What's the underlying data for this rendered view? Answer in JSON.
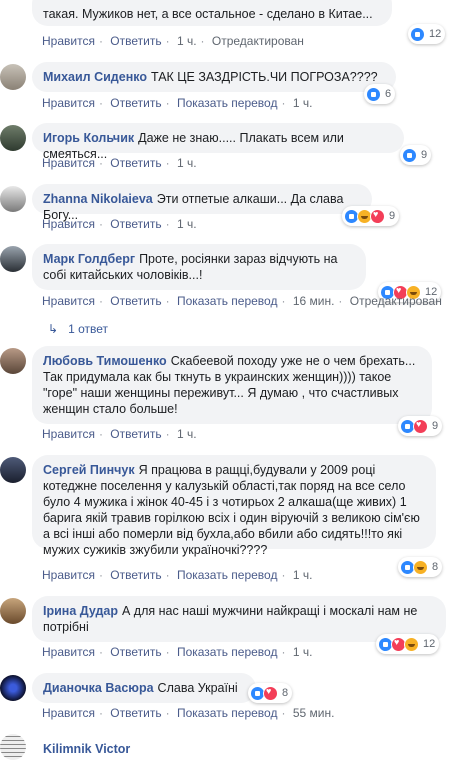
{
  "comments": [
    {
      "author": "",
      "text": "такая. Мужиков нет, а все остальное - сделано в Китае...",
      "actions": [
        "Нравится",
        "Ответить"
      ],
      "time": "1 ч.",
      "edited": "Отредактирован",
      "reactions": [
        "like"
      ],
      "reaction_count": "12"
    },
    {
      "author": "Михаил Сиденко",
      "text": "ТАК ЦЕ ЗАЗДРІСТЬ.ЧИ ПОГРОЗА????",
      "actions": [
        "Нравится",
        "Ответить",
        "Показать перевод"
      ],
      "time": "1 ч.",
      "reactions": [
        "like"
      ],
      "reaction_count": "6"
    },
    {
      "author": "Игорь Кольчик",
      "text": "Даже не знаю..... Плакать всем или смеяться...",
      "actions": [
        "Нравится",
        "Ответить"
      ],
      "time": "1 ч.",
      "reactions": [
        "like"
      ],
      "reaction_count": "9"
    },
    {
      "author": "Zhanna Nikolaieva",
      "text": "Эти отпетые алкаши... Да слава Богу...",
      "actions": [
        "Нравится",
        "Ответить"
      ],
      "time": "1 ч.",
      "reactions": [
        "like",
        "haha",
        "love"
      ],
      "reaction_count": "9"
    },
    {
      "author": "Марк Голдберг",
      "text": "Проте, росіянки зараз відчують на собі китайських чоловіків...!",
      "actions": [
        "Нравится",
        "Ответить",
        "Показать перевод"
      ],
      "time": "16 мин.",
      "edited": "Отредактирован",
      "reactions": [
        "like",
        "love",
        "haha"
      ],
      "reaction_count": "12"
    },
    {
      "author": "Любовь Тимошенко",
      "text": "Скабеевой походу уже не о чем брехать... Так придумала как бы ткнуть в украинских женщин)))) такое \"горе\" наши женщины переживут... Я думаю , что счастливых женщин стало больше!",
      "actions": [
        "Нравится",
        "Ответить"
      ],
      "time": "1 ч.",
      "reactions": [
        "like",
        "love"
      ],
      "reaction_count": "9"
    },
    {
      "author": "Сергей Пинчук",
      "text": "Я працюва в ращці,будували у 2009 році котеджне поселення у калузькій області,так поряд на все село було 4 мужика і жінок 40-45 і з чотирьох 2 алкаша(ще живих) 1 барига якій травив горілкою всіх і один віруючій з великою сім'єю а всі інші або померли від бухла,або вбили або сидять!!!то які мужих сужиків зжубили україночкі????",
      "actions": [
        "Нравится",
        "Ответить",
        "Показать перевод"
      ],
      "time": "1 ч.",
      "reactions": [
        "like",
        "haha"
      ],
      "reaction_count": "8"
    },
    {
      "author": "Iрина Дудар",
      "text": "А для нас наші мужчини найкращі і москалі нам не потрібні",
      "actions": [
        "Нравится",
        "Ответить",
        "Показать перевод"
      ],
      "time": "1 ч.",
      "reactions": [
        "like",
        "love",
        "haha"
      ],
      "reaction_count": "12"
    },
    {
      "author": "Дианочка Васюра",
      "text": "Слава Україні",
      "actions": [
        "Нравится",
        "Ответить",
        "Показать перевод"
      ],
      "time": "55 мин.",
      "reactions": [
        "like",
        "love"
      ],
      "reaction_count": "8"
    },
    {
      "author": "Kilimnik Victor",
      "text": "",
      "actions": [],
      "time": "",
      "reactions": [],
      "reaction_count": ""
    }
  ],
  "replies_label": "1 ответ",
  "colors": {
    "link": "#385898",
    "bubble": "#f2f3f5",
    "meta": "#606770"
  }
}
